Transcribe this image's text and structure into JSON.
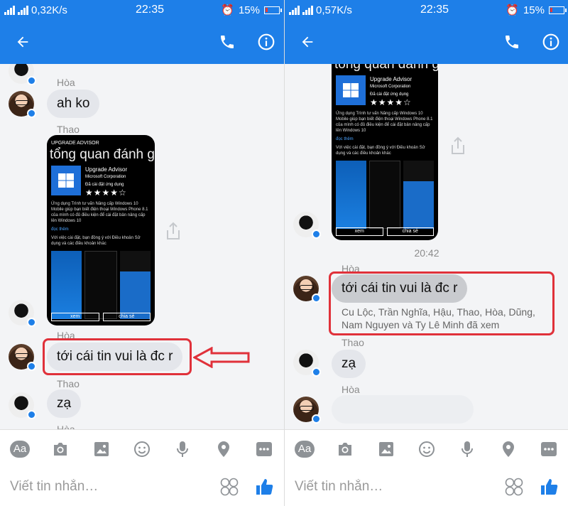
{
  "left": {
    "status": {
      "network": "0,32K/s",
      "time": "22:35",
      "battery": "15%"
    },
    "messages": {
      "s1": "Hòa",
      "b1": "ah ko",
      "s2": "Thao",
      "s3": "Hòa",
      "b3": "tới cái tin vui là đc r",
      "s4": "Thao",
      "b4": "zạ",
      "s5": "Hòa"
    },
    "shot": {
      "header": "UPGRADE ADVISOR",
      "heading": "tổng quan  đánh giá",
      "app_name": "Upgrade Advisor",
      "publisher": "Microsoft Corporation",
      "installed": "Đã cài đặt ứng dụng",
      "stars": "★★★★☆",
      "desc": "Ứng dụng Trình tư vấn Nâng cấp Windows 10 Mobile giúp bạn biết điện thoại Windows Phone 8.1 của mình có đủ điều kiện để cài đặt bản nâng cấp lên Windows 10",
      "more": "đọc thêm",
      "terms": "Với việc cài đặt, bạn đồng ý với Điều khoản Sử dụng và các điều khoản khác",
      "btn_view": "xem",
      "btn_share": "chia sẻ"
    },
    "composer": {
      "placeholder": "Viết tin nhắn…"
    }
  },
  "right": {
    "status": {
      "network": "0,57K/s",
      "time": "22:35",
      "battery": "15%"
    },
    "timestamp": "20:42",
    "messages": {
      "s1": "Hòa",
      "b1": "tới cái tin vui là đc r",
      "read": "Cu Lộc, Trần Nghĩa, Hậu, Thao, Hòa, Dũng, Nam Nguyen và Ty Lê Minh đã xem",
      "s2": "Thao",
      "b2": "zạ",
      "s3": "Hòa"
    },
    "shot": {
      "heading": "tổng quan  đánh giá",
      "app_name": "Upgrade Advisor",
      "publisher": "Microsoft Corporation",
      "installed": "Đã cài đặt ứng dụng",
      "stars": "★★★★☆",
      "desc": "Ứng dụng Trình tư vấn Nâng cấp Windows 10 Mobile giúp bạn biết điện thoại Windows Phone 8.1 của mình có đủ điều kiện để cài đặt bản nâng cấp lên Windows 10",
      "more": "đọc thêm",
      "terms": "Với việc cài đặt, bạn đồng ý với Điều khoản Sử dụng và các điều khoản khác",
      "btn_view": "xem",
      "btn_share": "chia sẻ"
    },
    "composer": {
      "placeholder": "Viết tin nhắn…"
    }
  },
  "colors": {
    "accent": "#1e7fe8",
    "bubble": "#e4e6eb",
    "highlight": "#e0313a"
  },
  "icons": [
    "back-arrow-icon",
    "phone-icon",
    "info-icon",
    "camera-icon",
    "image-icon",
    "smiley-icon",
    "mic-icon",
    "location-icon",
    "more-icon",
    "share-icon",
    "sticker-icon",
    "thumbs-up-icon"
  ]
}
